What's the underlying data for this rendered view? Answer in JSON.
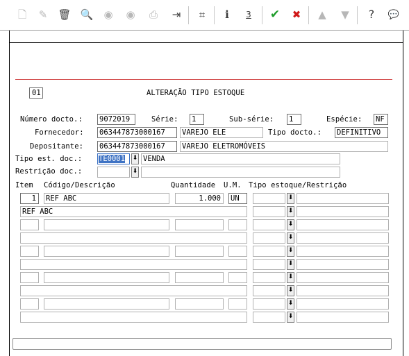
{
  "toolbar": {
    "icons": [
      "new-doc",
      "edit",
      "trash",
      "search",
      "prev",
      "next",
      "print",
      "exit",
      "binoculars",
      "info",
      "underline-3",
      "confirm-check",
      "cancel-x",
      "up",
      "down",
      "help",
      "chat"
    ],
    "glyphs": {
      "new": "🗋",
      "edit": "✎",
      "trash": "🗑",
      "search": "🔍",
      "prev": "◉",
      "next": "◉",
      "print": "⎙",
      "exit": "⇥",
      "find": "⌗",
      "info": "i",
      "three": "3",
      "ok": "✔",
      "cancel": "✖",
      "up": "▲",
      "down": "▼",
      "help": "?",
      "chat": "💬"
    },
    "accent_ok": "#1e9c2a",
    "accent_cancel": "#d01818"
  },
  "header": {
    "code": "01",
    "title": "ALTERAÇÃO TIPO ESTOQUE"
  },
  "form": {
    "numero_label": "Número docto.:",
    "numero_value": "9072019",
    "serie_label": "Série:",
    "serie_value": "1",
    "subserie_label": "Sub-série:",
    "subserie_value": "1",
    "especie_label": "Espécie:",
    "especie_value": "NF",
    "fornecedor_label": "Fornecedor:",
    "fornecedor_code": "063447873000167",
    "fornecedor_name": "VAREJO ELE",
    "tipo_docto_label": "Tipo docto.:",
    "tipo_docto_value": "DEFINITIVO",
    "depositante_label": "Depositante:",
    "depositante_code": "063447873000167",
    "depositante_name": "VAREJO ELETROMÓVEIS",
    "tipo_est_label": "Tipo est. doc.:",
    "tipo_est_value": "TE0001",
    "tipo_est_desc": "VENDA",
    "restricao_label": "Restrição doc.:",
    "restricao_value": "",
    "restricao_desc": ""
  },
  "grid": {
    "headers": {
      "item": "Item",
      "codigo": "Código/Descrição",
      "quantidade": "Quantidade",
      "um": "U.M.",
      "tipo": "Tipo estoque/Restrição"
    },
    "rows": [
      {
        "item": "1",
        "codigo": "REF ABC",
        "quantidade": "1.000",
        "um": "UN",
        "tipo": "",
        "desc": "REF ABC"
      },
      {
        "item": "",
        "codigo": "",
        "quantidade": "",
        "um": "",
        "tipo": "",
        "desc": ""
      },
      {
        "item": "",
        "codigo": "",
        "quantidade": "",
        "um": "",
        "tipo": "",
        "desc": ""
      },
      {
        "item": "",
        "codigo": "",
        "quantidade": "",
        "um": "",
        "tipo": "",
        "desc": ""
      },
      {
        "item": "",
        "codigo": "",
        "quantidade": "",
        "um": "",
        "tipo": "",
        "desc": ""
      }
    ]
  },
  "dropdown_glyph": "⬇",
  "status": ""
}
